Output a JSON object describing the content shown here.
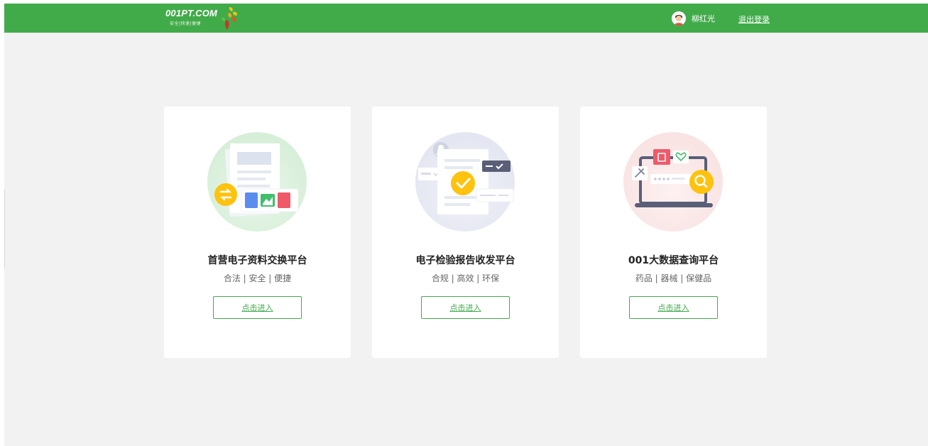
{
  "header": {
    "logo_text": "001PT.COM",
    "logo_sub": "安全|快速|便捷",
    "user_name": "柳红光",
    "logout_label": "退出登录"
  },
  "colors": {
    "brand_green": "#41ab4a",
    "background": "#f2f2f2",
    "accent_yellow": "#ffc20e"
  },
  "cards": [
    {
      "icon": "document-exchange-illustration",
      "title": "首营电子资料交换平台",
      "subtitle": "合法 | 安全 | 便捷",
      "button_label": "点击进入"
    },
    {
      "icon": "report-check-illustration",
      "title": "电子检验报告收发平台",
      "subtitle": "合规 | 高效 | 环保",
      "button_label": "点击进入"
    },
    {
      "icon": "data-search-illustration",
      "title": "001大数据查询平台",
      "subtitle": "药品 | 器械 | 保健品",
      "button_label": "点击进入"
    }
  ]
}
